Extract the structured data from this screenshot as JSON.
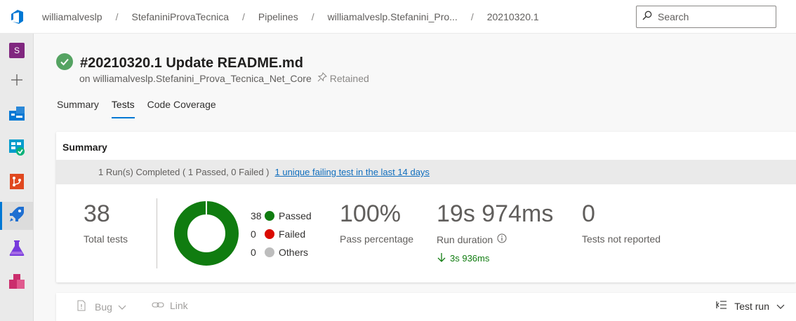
{
  "header": {
    "breadcrumbs": [
      "williamalveslp",
      "StefaniniProvaTecnica",
      "Pipelines",
      "williamalveslp.Stefanini_Pro...",
      "20210320.1"
    ],
    "search_placeholder": "Search"
  },
  "sidebar": {
    "project_initial": "S"
  },
  "build": {
    "title": "#20210320.1 Update README.md",
    "subtitle": "on williamalveslp.Stefanini_Prova_Tecnica_Net_Core",
    "retained": "Retained",
    "status_color": "#55a362"
  },
  "tabs": [
    "Summary",
    "Tests",
    "Code Coverage"
  ],
  "active_tab": "Tests",
  "summary": {
    "heading": "Summary",
    "banner_text": "1 Run(s) Completed ( 1 Passed, 0 Failed )",
    "banner_link": "1 unique failing test in the last 14 days",
    "total_tests": "38",
    "total_tests_label": "Total tests",
    "legend": [
      {
        "count": "38",
        "label": "Passed",
        "color": "#107c10"
      },
      {
        "count": "0",
        "label": "Failed",
        "color": "#da0a00"
      },
      {
        "count": "0",
        "label": "Others",
        "color": "#bdbdbd"
      }
    ],
    "pass_percentage": "100%",
    "pass_percentage_label": "Pass percentage",
    "run_duration": "19s 974ms",
    "run_duration_label": "Run duration",
    "duration_delta": "3s 936ms",
    "not_reported": "0",
    "not_reported_label": "Tests not reported"
  },
  "chart_data": {
    "type": "pie",
    "categories": [
      "Passed",
      "Failed",
      "Others"
    ],
    "values": [
      38,
      0,
      0
    ]
  },
  "toolbar": {
    "bug_label": "Bug",
    "link_label": "Link",
    "test_run_label": "Test run"
  }
}
